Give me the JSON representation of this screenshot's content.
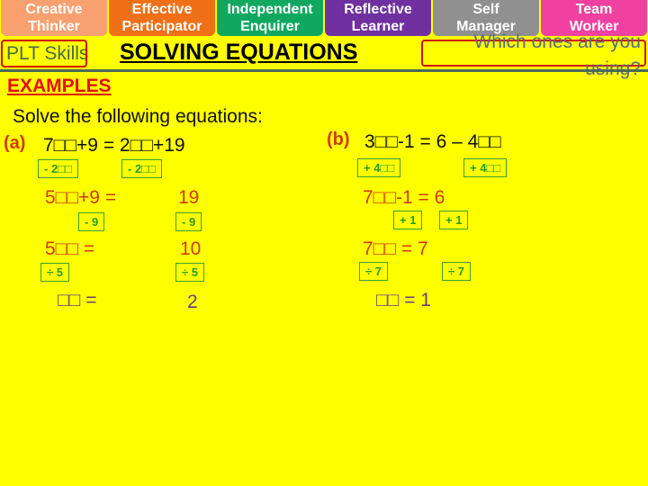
{
  "plt_tabs": [
    {
      "label1": "Creative",
      "label2": "Thinker",
      "color": "#f8a070"
    },
    {
      "label1": "Effective",
      "label2": "Participator",
      "color": "#f07018"
    },
    {
      "label1": "Independent",
      "label2": "Enquirer",
      "color": "#10a860"
    },
    {
      "label1": "Reflective",
      "label2": "Learner",
      "color": "#7030a0"
    },
    {
      "label1": "Self",
      "label2": "Manager",
      "color": "#909090"
    },
    {
      "label1": "Team",
      "label2": "Worker",
      "color": "#f040a0"
    }
  ],
  "plt_label": "PLT Skills",
  "title": "SOLVING EQUATIONS",
  "question": "Which ones are you using?",
  "examples": "EXAMPLES",
  "instruction": "Solve the following equations:",
  "a": {
    "label": "(a)",
    "eq": "7□□+9 = 2□□+19",
    "step1": [
      "- 2□□",
      "- 2□□"
    ],
    "l2": "5□□+9 =",
    "r2": "19",
    "step2": [
      "- 9",
      "- 9"
    ],
    "l3": "5□□  =",
    "r3": "10",
    "step3": [
      "÷ 5",
      "÷ 5"
    ],
    "l4": "□□  =",
    "r4": "2"
  },
  "b": {
    "label": "(b)",
    "eq": "3□□-1 = 6 – 4□□",
    "step1": [
      "+ 4□□",
      "+ 4□□"
    ],
    "l2": "7□□-1 = 6",
    "step2": [
      "+ 1",
      "+ 1"
    ],
    "l3": "7□□  = 7",
    "step3": [
      "÷ 7",
      "÷ 7"
    ],
    "l4": "□□  = 1"
  }
}
